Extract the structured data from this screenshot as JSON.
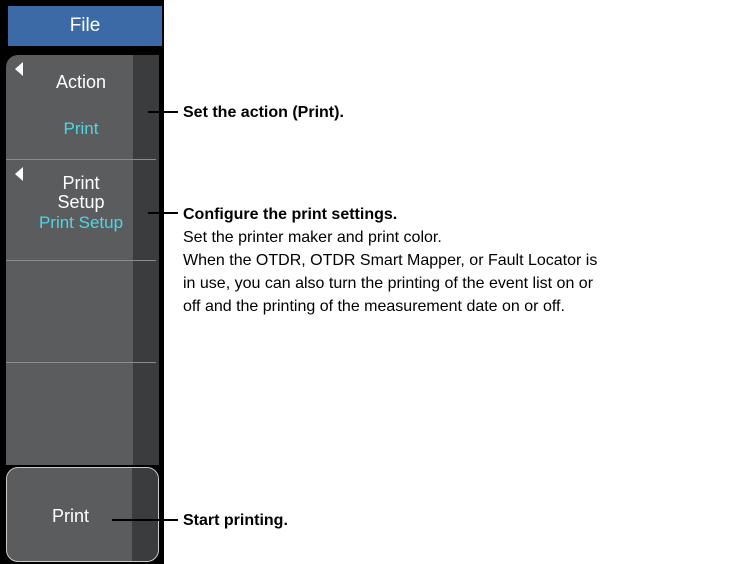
{
  "screen": {
    "title": "File"
  },
  "menu": {
    "action": {
      "label": "Action",
      "value": "Print"
    },
    "print_setup": {
      "label_line1": "Print",
      "label_line2": "Setup",
      "value": "Print Setup"
    },
    "print_button": {
      "label": "Print"
    }
  },
  "callouts": {
    "action": "Set the action (Print).",
    "setup_title": "Configure the print settings.",
    "setup_lines": [
      "Set the printer maker and print color.",
      "When the OTDR, OTDR Smart Mapper, or Fault Locator is",
      "in use, you can also turn the printing of the event list on or",
      "off and the printing of the measurement date on or off."
    ],
    "start": "Start printing."
  },
  "colors": {
    "title_bar": "#3b6aa6",
    "panel": "#5a5c5e",
    "value_text": "#4fd6e8"
  }
}
